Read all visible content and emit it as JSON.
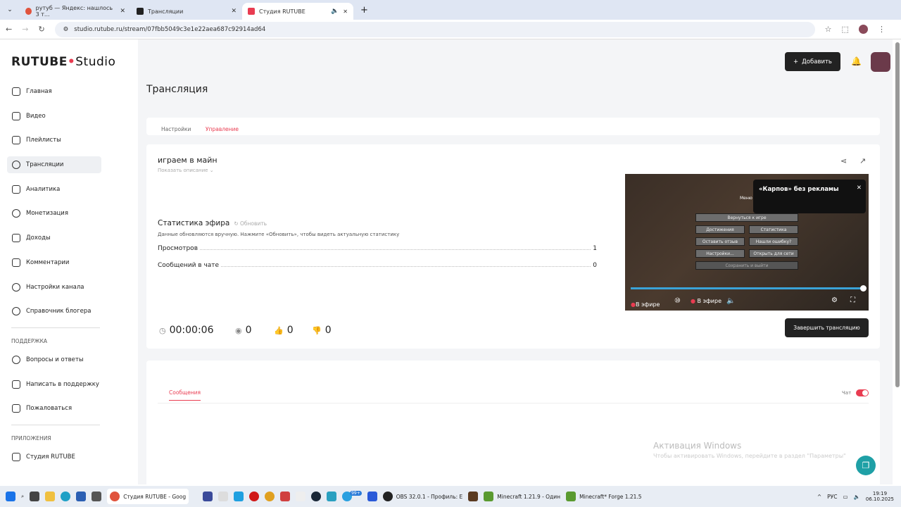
{
  "browser": {
    "tabs": [
      {
        "label": "рутуб — Яндекс: нашлось 3 т...",
        "color": "#e0533d"
      },
      {
        "label": "Трансляции",
        "color": "#222"
      },
      {
        "label": "Студия RUTUBE",
        "color": "#e93c51"
      }
    ],
    "url": "studio.rutube.ru/stream/07fbb5049c3e1e22aea687c92914ad64"
  },
  "header": {
    "logo": "RUTUBE",
    "logo_suffix": "Studio",
    "add_label": "Добавить"
  },
  "sidebar": {
    "items": [
      {
        "label": "Главная"
      },
      {
        "label": "Видео"
      },
      {
        "label": "Плейлисты"
      },
      {
        "label": "Трансляции"
      },
      {
        "label": "Аналитика"
      },
      {
        "label": "Монетизация"
      },
      {
        "label": "Доходы"
      },
      {
        "label": "Комментарии"
      },
      {
        "label": "Настройки канала"
      },
      {
        "label": "Справочник блогера"
      }
    ],
    "support_title": "ПОДДЕРЖКА",
    "support": [
      {
        "label": "Вопросы и ответы"
      },
      {
        "label": "Написать в поддержку"
      },
      {
        "label": "Пожаловаться"
      }
    ],
    "apps_title": "ПРИЛОЖЕНИЯ",
    "apps": [
      {
        "label": "Студия RUTUBE"
      }
    ]
  },
  "page": {
    "title": "Трансляция",
    "tabs": [
      "Настройки",
      "Управление"
    ]
  },
  "stream": {
    "name": "играем в майн",
    "show_description": "Показать описание",
    "stats_title": "Статистика эфира",
    "refresh": "Обновить",
    "stats_note": "Данные обновляются вручную. Нажмите «Обновить», чтобы видеть актуальную статистику",
    "stats": [
      {
        "label": "Просмотров",
        "value": "1"
      },
      {
        "label": "Сообщений в чате",
        "value": "0"
      }
    ],
    "timer": "00:00:06",
    "viewers": "0",
    "likes": "0",
    "dislikes": "0",
    "end_label": "Завершить трансляцию"
  },
  "player": {
    "menu_title": "Меню",
    "buttons": [
      "Вернуться к игре",
      "Достижения",
      "Статистика",
      "Оставить отзыв",
      "Нашли ошибку?",
      "Настройки...",
      "Открыть для сети",
      "Сохранить и выйти"
    ],
    "ad_text": "«Карпов» без рекламы",
    "live_label": "В эфире",
    "live_label2": "В эфире",
    "progress": 1.0
  },
  "chat": {
    "tab": "Сообщения",
    "toggle_label": "Чат",
    "enabled": true
  },
  "watermark": {
    "title": "Активация Windows",
    "text": "Чтобы активировать Windows, перейдите в раздел \"Параметры\""
  },
  "taskbar": {
    "apps": [
      {
        "label": "Студия RUTUBE - Goog"
      },
      {
        "label": "OBS 32.0.1 - Профиль: E"
      },
      {
        "label": "Minecraft 1.21.9 - Один"
      },
      {
        "label": "Minecraft* Forge 1.21.5"
      }
    ],
    "lang": "РУС",
    "time": "19:19",
    "date": "06.10.2025",
    "badge": "99+"
  }
}
